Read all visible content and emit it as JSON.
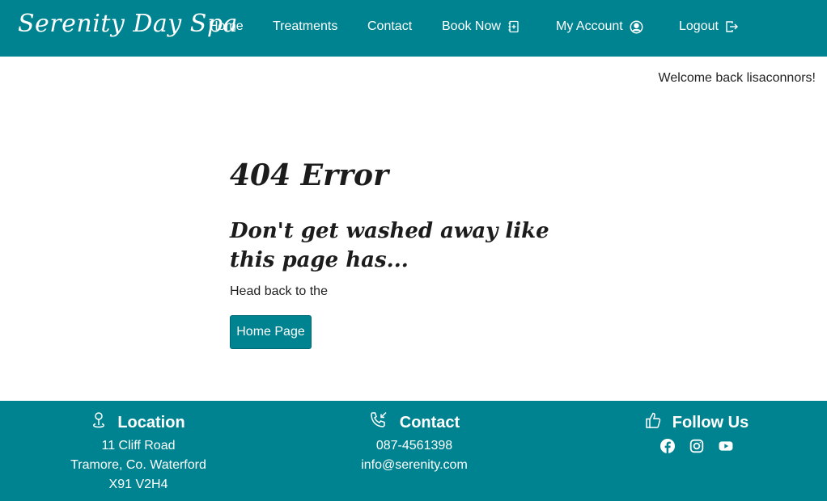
{
  "navbar": {
    "brand": "Serenity Day Spa",
    "links": {
      "home": "Home",
      "treatments": "Treatments",
      "contact": "Contact",
      "book_now": "Book Now",
      "my_account": "My Account",
      "logout": "Logout"
    }
  },
  "welcome_message": "Welcome back lisaconnors!",
  "main": {
    "title": "404 Error",
    "subtitle": "Don't get washed away like this page has...",
    "prompt": "Head back to the",
    "home_button": "Home Page"
  },
  "footer": {
    "location": {
      "heading": "Location",
      "lines": [
        "11 Cliff Road",
        "Tramore, Co. Waterford",
        "X91 V2H4"
      ]
    },
    "contact": {
      "heading": "Contact",
      "phone": "087-4561398",
      "email": "info@serenity.com"
    },
    "follow": {
      "heading": "Follow Us",
      "icons": [
        "facebook-icon",
        "instagram-icon",
        "youtube-icon"
      ]
    }
  },
  "colors": {
    "primary": "#008390",
    "text": "#222222",
    "background": "#ffffff"
  }
}
